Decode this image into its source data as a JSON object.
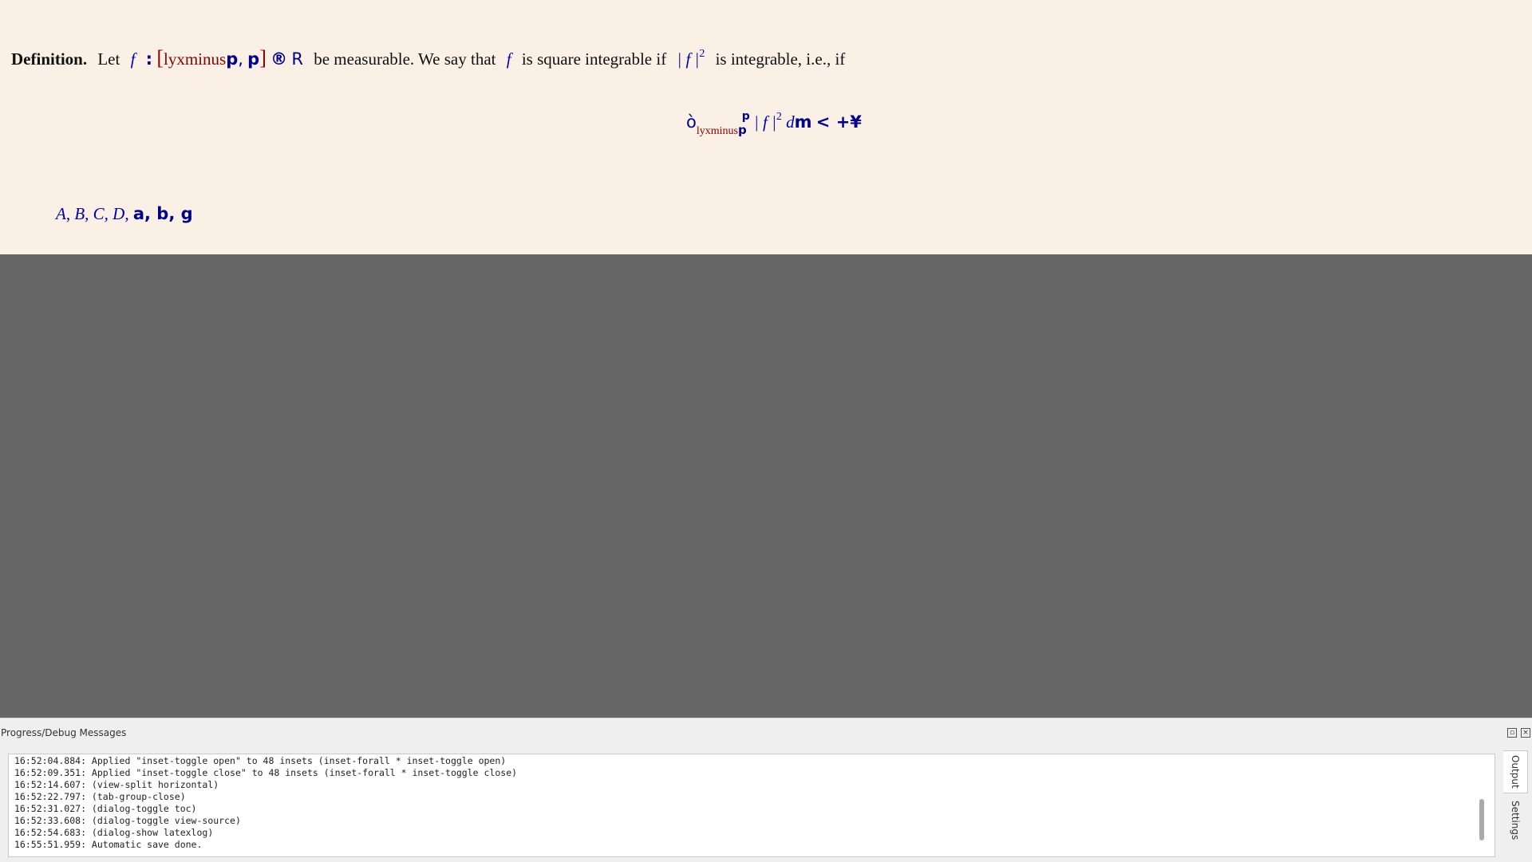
{
  "document": {
    "definition_label": "Definition.",
    "let": "Let",
    "f": "f",
    "colon": ":",
    "bracket_open": "[",
    "lyxminus": "lyxminus",
    "p1": "p",
    "comma": ",",
    "p2": "p",
    "bracket_close": "]",
    "arrow": "®",
    "R": "R",
    "text1": "be measurable. We say that",
    "f2": "f",
    "text2": "is square integrable if",
    "abs_f": "| f |",
    "sq": "2",
    "text3": "is integrable, i.e., if",
    "display": {
      "integral": "ò",
      "upper": "p",
      "lower_red": "lyxminus",
      "lower_bold": "p",
      "abs_f": "| f |",
      "sq": "2",
      "d": "d",
      "mu": "m",
      "lt_inf": "< +¥"
    },
    "symbols_italic": "A, B, C, D,",
    "symbols_bold": "a, b, g"
  },
  "panel": {
    "title": "Progress/Debug Messages",
    "float_icon": "float-icon",
    "close_icon": "close-icon",
    "log_lines": [
      "16:52:04.884: Applied \"inset-toggle open\" to 48 insets (inset-forall * inset-toggle open)",
      "16:52:09.351: Applied \"inset-toggle close\" to 48 insets (inset-forall * inset-toggle close)",
      "16:52:14.607: (view-split horizontal)",
      "16:52:22.797: (tab-group-close)",
      "16:52:31.027: (dialog-toggle toc)",
      "16:52:33.608: (dialog-toggle view-source)",
      "16:52:54.683: (dialog-show latexlog)",
      "16:55:51.959: Automatic save done."
    ],
    "tabs": {
      "output": "Output",
      "settings": "Settings"
    }
  }
}
